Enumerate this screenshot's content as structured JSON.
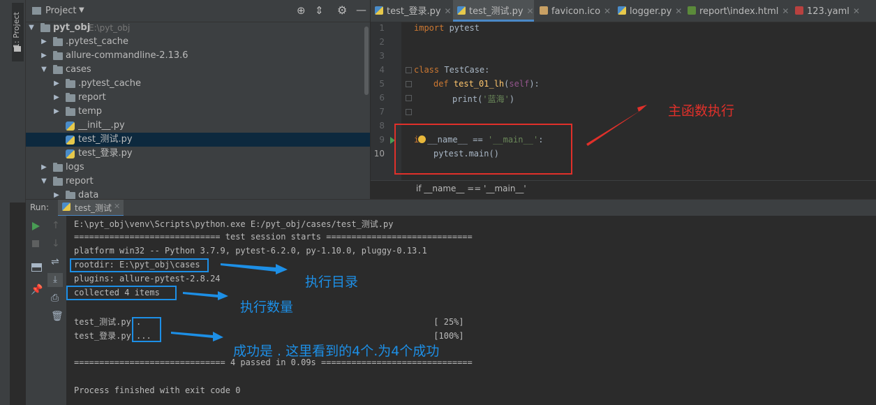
{
  "sidebar": {
    "tab_label": "1: Project"
  },
  "project_panel": {
    "title": "Project",
    "tree": [
      {
        "label": "pyt_obj",
        "hint": "E:\\pyt_obj",
        "type": "root"
      },
      {
        "label": ".pytest_cache",
        "type": "folder"
      },
      {
        "label": "allure-commandline-2.13.6",
        "type": "folder"
      },
      {
        "label": "cases",
        "type": "folder-open"
      },
      {
        "label": ".pytest_cache",
        "type": "folder"
      },
      {
        "label": "report",
        "type": "folder"
      },
      {
        "label": "temp",
        "type": "folder"
      },
      {
        "label": "__init__.py",
        "type": "py"
      },
      {
        "label": "test_测试.py",
        "type": "py"
      },
      {
        "label": "test_登录.py",
        "type": "py"
      },
      {
        "label": "logs",
        "type": "folder"
      },
      {
        "label": "report",
        "type": "folder-open"
      },
      {
        "label": "data",
        "type": "folder"
      }
    ]
  },
  "editor": {
    "tabs": [
      {
        "label": "test_登录.py"
      },
      {
        "label": "test_测试.py"
      },
      {
        "label": "favicon.ico"
      },
      {
        "label": "logger.py"
      },
      {
        "label": "report\\index.html"
      },
      {
        "label": "123.yaml"
      }
    ],
    "line_numbers": [
      "1",
      "2",
      "3",
      "4",
      "5",
      "6",
      "7",
      "8",
      "9",
      "10"
    ],
    "code": {
      "l1_kw": "import",
      "l1_mod": " pytest",
      "l4_kw": "class",
      "l4_name": " TestCase:",
      "l5_kw": "def",
      "l5_fn": " test_01_lh",
      "l5_open": "(",
      "l5_self": "self",
      "l5_close": "):",
      "l6_fn": "print(",
      "l6_str": "'蓝海'",
      "l6_close": ")",
      "l9_a": "i",
      "l9_b": "__name__ == ",
      "l9_str": "'__main__'",
      "l9_c": ":",
      "l10": "pytest.main()"
    },
    "breadcrumb": "if __name__ == '__main__'"
  },
  "run_panel": {
    "run_label": "Run:",
    "tab_label": "test_测试",
    "console_lines": [
      "E:\\pyt_obj\\venv\\Scripts\\python.exe E:/pyt_obj/cases/test_测试.py",
      "============================= test session starts =============================",
      "platform win32 -- Python 3.7.9, pytest-6.2.0, py-1.10.0, pluggy-0.13.1",
      "rootdir: E:\\pyt_obj\\cases",
      "plugins: allure-pytest-2.8.24",
      "collected 4 items",
      "",
      "test_测试.py .                                                          [ 25%]",
      "test_登录.py ...                                                        [100%]",
      "",
      "============================== 4 passed in 0.09s ==============================",
      "",
      "Process finished with exit code 0"
    ]
  },
  "annotations": {
    "main_func": "主函数执行",
    "exec_dir": "执行目录",
    "exec_count": "执行数量",
    "success": "成功是 . 这里看到的4个.为4个成功"
  },
  "colors": {
    "red": "#e0302a",
    "blue": "#1d8fe6",
    "accent": "#4a88c7"
  }
}
